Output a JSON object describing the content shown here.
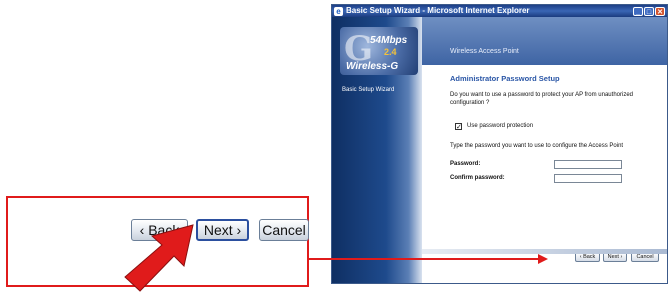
{
  "callout": {
    "back_label": "‹ Back",
    "next_label": "Next ›",
    "cancel_label": "Cancel"
  },
  "window": {
    "title": "Basic Setup Wizard - Microsoft Internet Explorer",
    "app_icon": "ie-icon",
    "controls": {
      "minimize": "_",
      "maximize": "□",
      "close": "✕"
    }
  },
  "sidebar": {
    "logo": {
      "speed": "54Mbps",
      "band": "2.4",
      "brand": "Wireless-G"
    },
    "label": "Basic Setup Wizard"
  },
  "header": {
    "title": "Wireless Access Point"
  },
  "main": {
    "section_title": "Administrator Password Setup",
    "question": "Do you want to use a password to protect your AP from unauthorized configuration ?",
    "checkbox_label": "Use password protection",
    "checkbox_checked": true,
    "instruction": "Type the password you want to use to configure the Access Point",
    "password_label": "Password:",
    "confirm_label": "Confirm password:",
    "password_value": "",
    "confirm_value": "",
    "buttons": {
      "back": "‹ Back",
      "next": "Next ›",
      "cancel": "Cancel"
    }
  },
  "colors": {
    "highlight_red": "#e01b1b",
    "title_blue": "#2a56a6",
    "titlebar_blue": "#1d3f86"
  }
}
